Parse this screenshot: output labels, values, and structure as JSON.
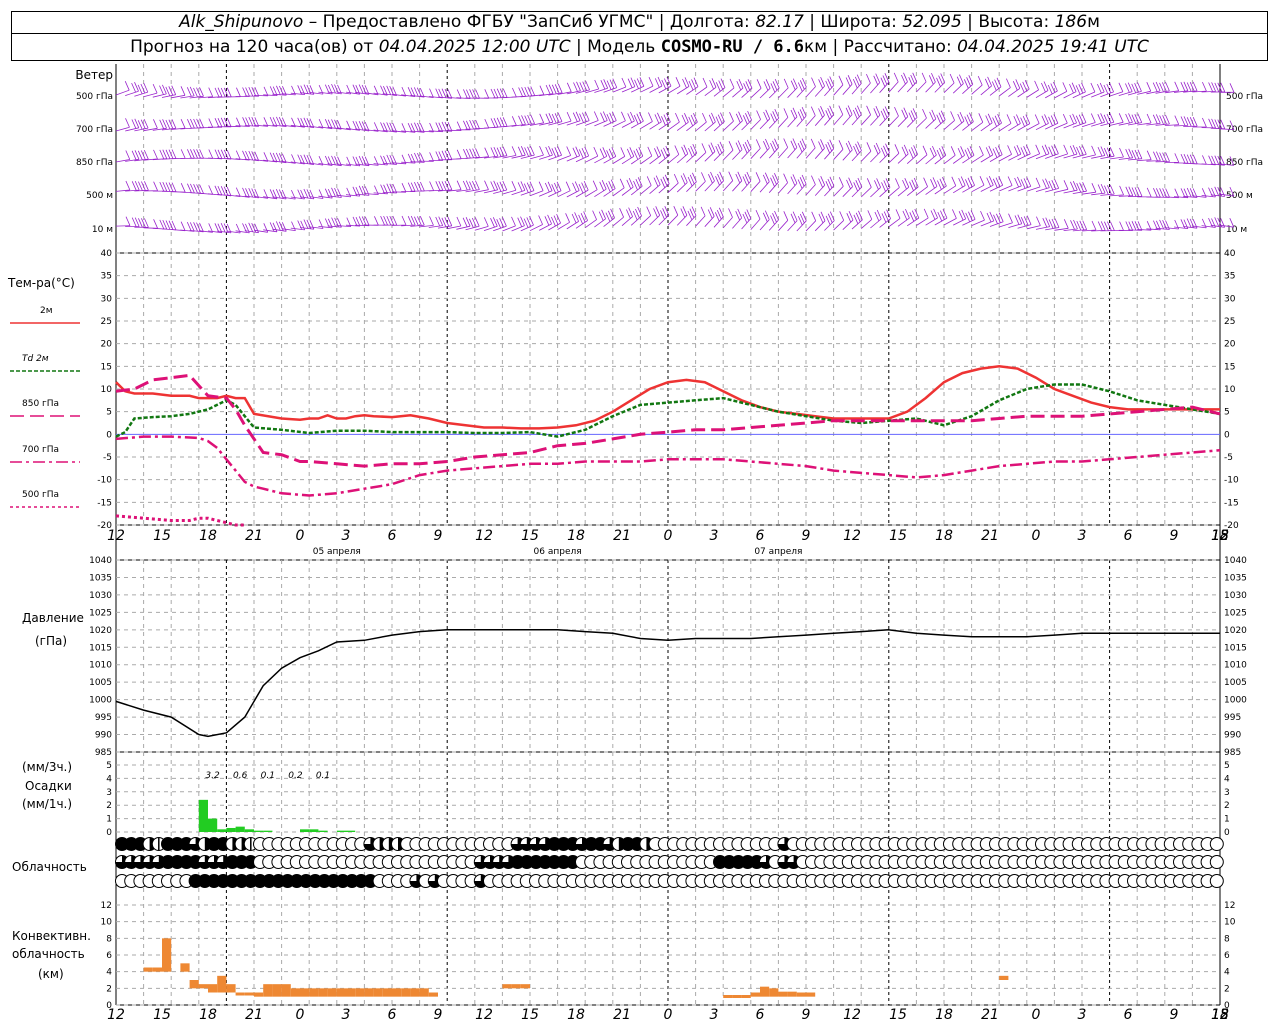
{
  "header": {
    "station": "Alk_Shipunovo",
    "provider": "– Предоставлено ФГБУ \"ЗапСиб УГМС\"",
    "lon_label": "Долгота:",
    "lon": "82.17",
    "lat_label": "Широта:",
    "lat": "52.095",
    "alt_label": "Высота:",
    "alt": "186",
    "alt_unit": "м",
    "forecast_text": "Прогноз на 120 часа(ов) от",
    "forecast_time": "04.04.2025 12:00 UTC",
    "model_label": "Модель",
    "model": "COSMO-RU / 6.6",
    "model_unit": "км",
    "computed_label": "Рассчитано:",
    "computed_time": "04.04.2025 19:41 UTC"
  },
  "wind_panel": {
    "title": "Ветер",
    "levels": [
      "500 гПа",
      "700 гПа",
      "850 гПа",
      "500 м",
      "10  м"
    ]
  },
  "temp_panel": {
    "title": "Тем-ра(°С)",
    "legend": [
      {
        "label": "2м",
        "color": "#ee3333",
        "dash": ""
      },
      {
        "label": "Td  2м",
        "color": "#117711",
        "dash": "4,2"
      },
      {
        "label": "850 гПа",
        "color": "#dd1177",
        "dash": "14,6"
      },
      {
        "label": "700 гПа",
        "color": "#dd1177",
        "dash": "12,4,3,4"
      },
      {
        "label": "500 гПа",
        "color": "#dd1177",
        "dash": "3,3"
      }
    ],
    "yticks": [
      "40",
      "35",
      "30",
      "25",
      "20",
      "15",
      "10",
      "5",
      "0",
      "-5",
      "-10",
      "-15",
      "-20"
    ],
    "xticks": [
      "12",
      "15",
      "18",
      "21",
      "0",
      "3",
      "6",
      "9",
      "12",
      "15",
      "18",
      "21",
      "0",
      "3",
      "6",
      "9",
      "12",
      "15",
      "18",
      "21",
      "0",
      "3",
      "6",
      "9",
      "12",
      "15",
      "18"
    ],
    "dates": [
      "05 апреля",
      "06 апреля",
      "07 апреля"
    ]
  },
  "pressure_panel": {
    "title1": "Давление",
    "title2": "(гПа)",
    "yticks": [
      "1040",
      "1035",
      "1030",
      "1025",
      "1020",
      "1015",
      "1010",
      "1005",
      "1000",
      "995",
      "990",
      "985"
    ]
  },
  "precip_panel": {
    "title_unit3": "(мм/3ч.)",
    "title": "Осадки",
    "title_unit1": "(мм/1ч.)",
    "yticks": [
      "5",
      "4",
      "3",
      "2",
      "1",
      "0"
    ],
    "totals": [
      "3.2",
      "0.6",
      "0.1",
      "0.2",
      "0.1"
    ]
  },
  "cloud_panel": {
    "title": "Облачность"
  },
  "conv_panel": {
    "title1": "Конвективн.",
    "title2": "облачность",
    "title3": "(км)",
    "yticks": [
      "12",
      "10",
      "8",
      "6",
      "4",
      "2",
      "0"
    ]
  },
  "colors": {
    "wind": "#9922cc",
    "t2m": "#ee3333",
    "td": "#117711",
    "upper": "#dd1177",
    "pressure": "#000000",
    "precip": "#22cc22",
    "conv": "#ee8833"
  },
  "chart_data": [
    {
      "type": "line",
      "title": "Тем-ра(°С)",
      "x_hours": [
        0,
        1,
        2,
        3,
        4,
        5,
        6,
        7,
        8,
        9,
        10,
        11,
        12,
        13,
        14,
        15,
        16,
        17,
        18,
        19,
        20,
        21,
        22,
        23,
        24,
        25,
        26,
        27,
        28,
        29,
        30,
        31,
        32,
        33,
        34,
        35,
        36,
        37,
        38,
        39,
        40,
        41,
        42,
        43,
        44,
        45,
        46,
        47,
        48,
        49,
        50,
        51,
        52,
        53,
        54,
        55,
        56,
        57,
        58,
        59,
        60,
        61,
        62,
        63,
        64,
        65,
        66,
        67,
        68,
        69,
        70,
        71,
        72,
        73,
        74,
        75,
        76,
        77,
        78,
        79,
        80,
        81,
        82,
        83,
        84,
        85,
        86,
        87,
        88,
        89,
        90,
        91,
        92,
        93,
        94,
        95,
        96,
        97,
        98,
        99,
        100,
        101,
        102,
        103,
        104,
        105,
        106,
        107,
        108,
        109,
        110,
        111,
        112,
        113,
        114,
        115,
        116,
        117,
        118,
        119,
        120
      ],
      "series": [
        {
          "name": "2м",
          "color": "#ee3333",
          "x": [
            0,
            1,
            2,
            4,
            6,
            8,
            9,
            10,
            11,
            12,
            13,
            14,
            15,
            18,
            20,
            21,
            22,
            23,
            24,
            25,
            26,
            27,
            28,
            30,
            32,
            34,
            36,
            38,
            40,
            42,
            44,
            46,
            48,
            50,
            52,
            54,
            56,
            58,
            60,
            62,
            64,
            66,
            68,
            70,
            72,
            74,
            76,
            78,
            80,
            82,
            84,
            86,
            88,
            90,
            92,
            94,
            96,
            98,
            100,
            102,
            104,
            106,
            108,
            110,
            112,
            114,
            116,
            118,
            120
          ],
          "values": [
            11.5,
            9.5,
            9.0,
            9.0,
            8.5,
            8.5,
            8.0,
            8.0,
            8.0,
            8.5,
            8.0,
            8.0,
            4.5,
            3.5,
            3.2,
            3.5,
            3.5,
            4.2,
            3.5,
            3.5,
            4.0,
            4.2,
            4.0,
            3.8,
            4.2,
            3.5,
            2.5,
            2.0,
            1.5,
            1.5,
            1.3,
            1.3,
            1.5,
            2.0,
            3.0,
            5.0,
            7.5,
            10.0,
            11.5,
            12.0,
            11.5,
            9.5,
            7.5,
            6.0,
            5.0,
            4.5,
            4.0,
            3.5,
            3.5,
            3.5,
            3.5,
            5.0,
            8.0,
            11.5,
            13.5,
            14.5,
            15.0,
            14.5,
            12.5,
            10.0,
            8.5,
            7.0,
            6.0,
            5.5,
            5.5,
            5.5,
            5.5,
            5.5,
            5.5
          ]
        },
        {
          "name": "Td  2м",
          "color": "#117711",
          "x": [
            0,
            1,
            2,
            4,
            6,
            8,
            10,
            12,
            13,
            14,
            15,
            18,
            21,
            24,
            27,
            30,
            33,
            36,
            39,
            42,
            45,
            48,
            51,
            54,
            57,
            60,
            63,
            66,
            69,
            72,
            75,
            78,
            81,
            84,
            87,
            90,
            93,
            96,
            99,
            102,
            105,
            108,
            111,
            114,
            117,
            120
          ],
          "values": [
            -0.5,
            0.5,
            3.5,
            3.8,
            4.0,
            4.5,
            5.5,
            7.5,
            6.5,
            4.0,
            1.5,
            1.0,
            0.3,
            0.8,
            0.8,
            0.5,
            0.5,
            0.5,
            0.3,
            0.3,
            0.5,
            -0.5,
            1.0,
            4.0,
            6.5,
            7.0,
            7.5,
            8.0,
            6.5,
            5.0,
            4.0,
            3.0,
            2.5,
            3.0,
            3.5,
            2.0,
            4.0,
            7.5,
            10.0,
            11.0,
            11.0,
            9.5,
            7.5,
            6.5,
            5.5,
            4.5
          ]
        },
        {
          "name": "850 гПа",
          "color": "#dd1177",
          "x": [
            0,
            2,
            4,
            6,
            8,
            10,
            12,
            13,
            14,
            15,
            16,
            18,
            20,
            21,
            24,
            27,
            30,
            33,
            36,
            39,
            42,
            45,
            48,
            51,
            54,
            57,
            60,
            63,
            66,
            69,
            72,
            75,
            78,
            81,
            84,
            87,
            90,
            93,
            96,
            99,
            102,
            105,
            108,
            111,
            114,
            117,
            120
          ],
          "values": [
            9.5,
            10.0,
            12.0,
            12.5,
            13.0,
            8.5,
            8.0,
            5.5,
            2.0,
            -1.0,
            -4.0,
            -4.5,
            -6.0,
            -6.0,
            -6.5,
            -7.0,
            -6.5,
            -6.5,
            -6.0,
            -5.0,
            -4.5,
            -4.0,
            -2.5,
            -2.0,
            -1.0,
            0.0,
            0.5,
            1.0,
            1.0,
            1.5,
            2.0,
            2.5,
            3.0,
            3.0,
            3.0,
            3.0,
            3.0,
            3.0,
            3.5,
            4.0,
            4.0,
            4.0,
            4.5,
            5.0,
            5.5,
            6.0,
            4.5
          ]
        },
        {
          "name": "700 гПа",
          "color": "#dd1177",
          "x": [
            0,
            3,
            6,
            9,
            10,
            11,
            12,
            13,
            14,
            15,
            16,
            18,
            21,
            24,
            27,
            30,
            33,
            36,
            39,
            42,
            45,
            48,
            51,
            54,
            57,
            60,
            63,
            66,
            69,
            72,
            75,
            78,
            81,
            84,
            87,
            90,
            93,
            96,
            99,
            102,
            105,
            108,
            111,
            114,
            117,
            120
          ],
          "values": [
            -1.0,
            -0.5,
            -0.5,
            -0.8,
            -1.5,
            -3.0,
            -5.5,
            -8.0,
            -10.5,
            -11.5,
            -12.0,
            -13.0,
            -13.5,
            -13.0,
            -12.0,
            -11.0,
            -9.0,
            -8.0,
            -7.5,
            -7.0,
            -6.5,
            -6.5,
            -6.0,
            -6.0,
            -6.0,
            -5.5,
            -5.5,
            -5.5,
            -6.0,
            -6.5,
            -7.0,
            -8.0,
            -8.5,
            -9.0,
            -9.5,
            -9.0,
            -8.0,
            -7.0,
            -6.5,
            -6.0,
            -6.0,
            -5.5,
            -5.0,
            -4.5,
            -4.0,
            -3.5
          ]
        },
        {
          "name": "500 гПа",
          "color": "#dd1177",
          "x": [
            0,
            3,
            6,
            8,
            9,
            10,
            11,
            12,
            13,
            14
          ],
          "values": [
            -18.0,
            -18.5,
            -19.0,
            -19.0,
            -18.5,
            -18.5,
            -19.0,
            -19.5,
            -20.0,
            -20.0
          ]
        }
      ],
      "ylim": [
        -20,
        40
      ],
      "xticks": [
        "12",
        "15",
        "18",
        "21",
        "0",
        "3",
        "6",
        "9",
        "12",
        "15",
        "18",
        "21",
        "0",
        "3",
        "6",
        "9",
        "12",
        "15",
        "18",
        "21",
        "0",
        "3",
        "6",
        "9",
        "12",
        "15",
        "18"
      ]
    },
    {
      "type": "line",
      "title": "Давление",
      "ylabel": "(гПа)",
      "x_hours": [
        0,
        3,
        6,
        9,
        10,
        12,
        14,
        16,
        18,
        20,
        22,
        24,
        27,
        30,
        33,
        36,
        39,
        42,
        45,
        48,
        51,
        54,
        57,
        60,
        63,
        66,
        69,
        72,
        75,
        78,
        81,
        84,
        87,
        90,
        93,
        96,
        99,
        102,
        105,
        108,
        111,
        114,
        117,
        120
      ],
      "values": [
        999.5,
        997.0,
        995.0,
        990.0,
        989.5,
        990.5,
        995.0,
        1004.0,
        1009.0,
        1012.0,
        1014.0,
        1016.5,
        1017.0,
        1018.5,
        1019.5,
        1020.0,
        1020.0,
        1020.0,
        1020.0,
        1020.0,
        1019.5,
        1019.0,
        1017.5,
        1017.0,
        1017.5,
        1017.5,
        1017.5,
        1018.0,
        1018.5,
        1019.0,
        1019.5,
        1020.0,
        1019.0,
        1018.5,
        1018.0,
        1018.0,
        1018.0,
        1018.5,
        1019.0,
        1019.0,
        1019.0,
        1019.0,
        1019.0,
        1019.0
      ],
      "ylim": [
        985,
        1040
      ]
    },
    {
      "type": "bar",
      "title": "Осадки",
      "x_hours": [
        9,
        10,
        11,
        12,
        13,
        14,
        15,
        16,
        17,
        18,
        19,
        20,
        21,
        22,
        23,
        24,
        25
      ],
      "values": [
        2.4,
        1.0,
        0.2,
        0.3,
        0.4,
        0.2,
        0.1,
        0.1,
        0.0,
        0.0,
        0.0,
        0.2,
        0.2,
        0.1,
        0.0,
        0.1,
        0.1
      ],
      "totals_3h": [
        "3.2",
        "0.6",
        "0.1",
        "0.2",
        "0.1"
      ],
      "ylim": [
        0,
        5
      ]
    },
    {
      "type": "bar",
      "title": "Конвективн. облачность",
      "ylabel": "(км)",
      "x_hours": [
        3,
        4,
        5,
        7,
        8,
        9,
        10,
        11,
        12,
        13,
        14,
        15,
        16,
        17,
        18,
        19,
        20,
        21,
        22,
        23,
        24,
        25,
        26,
        27,
        28,
        29,
        30,
        31,
        32,
        33,
        34,
        42,
        43,
        44,
        66,
        67,
        68,
        69,
        70,
        71,
        72,
        73,
        74,
        75,
        96
      ],
      "base": [
        4,
        4,
        4,
        4,
        2,
        2,
        1.5,
        1.5,
        1.5,
        1.5,
        1.5,
        1,
        1,
        1,
        1,
        1,
        1,
        1,
        1,
        1,
        1,
        1,
        1,
        1,
        1,
        1,
        1,
        1,
        1,
        1,
        1,
        2,
        2,
        2,
        1,
        1,
        1,
        1,
        1,
        1,
        1,
        1,
        1,
        1,
        3
      ],
      "top": [
        4.5,
        4.5,
        8,
        5,
        3,
        2.5,
        2.5,
        3.5,
        2.5,
        1.5,
        1.5,
        1.5,
        2.5,
        2.5,
        2.5,
        2,
        2,
        2,
        2,
        2,
        2,
        2,
        2,
        2,
        2,
        2,
        2,
        2,
        2,
        2,
        1.5,
        2.5,
        2.5,
        2.5,
        1.2,
        1.2,
        1.2,
        1.5,
        2.2,
        2,
        1.6,
        1.6,
        1.5,
        1.5,
        3.5
      ],
      "ylim": [
        0,
        13
      ]
    }
  ],
  "cloud_rows": [
    "FFFHQFFF3HFFHHQEEEEEEEEEEEE3HHHEEEEEEEEEEEE3333FFF3FF3HFFHEEEEEEEEEEEEEE3EEEEEEEEEEEE",
    "33333FFFF333FFFEEEEEEEEEEEEEEEEEEEEEEEE3333FFFFFFFEEEEEEEEEEEEEEEFFFFF3E33EEEEEEEEEEEEEEEEEE",
    "EEEEEEEEFFFFFFFFFFFFFFFFFFFFEEEE3E3EEEE3EEEEEEEEEEEEEEEEEEEEEEEEEEEEEEEEEEEEEEEEEE"
  ]
}
